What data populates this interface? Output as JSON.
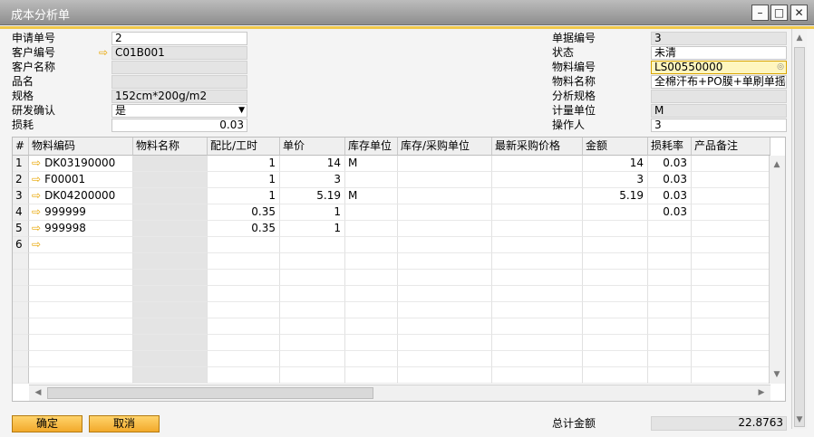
{
  "window": {
    "title": "成本分析单"
  },
  "header_left": [
    {
      "label": "申请单号",
      "value": "2",
      "style": "edit"
    },
    {
      "label": "客户编号",
      "value": "C01B001",
      "style": "ro",
      "arrow": true
    },
    {
      "label": "客户名称",
      "value": "",
      "style": "ro"
    },
    {
      "label": "品名",
      "value": "",
      "style": "ro"
    },
    {
      "label": "规格",
      "value": "152cm*200g/m2",
      "style": "ro"
    },
    {
      "label": "研发确认",
      "value": "是",
      "style": "select"
    },
    {
      "label": "损耗",
      "value": "0.03",
      "style": "num"
    }
  ],
  "header_right": [
    {
      "label": "单据编号",
      "value": "3",
      "style": "ro"
    },
    {
      "label": "状态",
      "value": "未清",
      "style": "edit"
    },
    {
      "label": "物料编号",
      "value": "LS00550000",
      "style": "active"
    },
    {
      "label": "物料名称",
      "value": "全棉汗布+PO膜+单刷单摇",
      "style": "edit"
    },
    {
      "label": "分析规格",
      "value": "",
      "style": "ro"
    },
    {
      "label": "计量单位",
      "value": "M",
      "style": "ro"
    },
    {
      "label": "操作人",
      "value": "3",
      "style": "edit"
    }
  ],
  "grid": {
    "columns": [
      "#",
      "物料编码",
      "物料名称",
      "配比/工时",
      "单价",
      "库存单位",
      "库存/采购单位",
      "最新采购价格",
      "金额",
      "损耗率",
      "产品备注"
    ],
    "rows": [
      [
        "1",
        "DK03190000",
        "",
        "1",
        "14",
        "M",
        "",
        "",
        "14",
        "0.03",
        ""
      ],
      [
        "2",
        "F00001",
        "",
        "1",
        "3",
        "",
        "",
        "",
        "3",
        "0.03",
        ""
      ],
      [
        "3",
        "DK04200000",
        "",
        "1",
        "5.19",
        "M",
        "",
        "",
        "5.19",
        "0.03",
        ""
      ],
      [
        "4",
        "999999",
        "",
        "0.35",
        "1",
        "",
        "",
        "",
        "",
        "0.03",
        ""
      ],
      [
        "5",
        "999998",
        "",
        "0.35",
        "1",
        "",
        "",
        "",
        "",
        "",
        ""
      ],
      [
        "6",
        "",
        "",
        "",
        "",
        "",
        "",
        "",
        "",
        "",
        ""
      ]
    ]
  },
  "footer": {
    "ok_label": "确定",
    "cancel_label": "取消",
    "total_label": "总计金额",
    "total_value": "22.8763"
  },
  "colors": {
    "accent": "#f0c84a",
    "button": "#f2a92b",
    "arrow": "#e8a500"
  }
}
